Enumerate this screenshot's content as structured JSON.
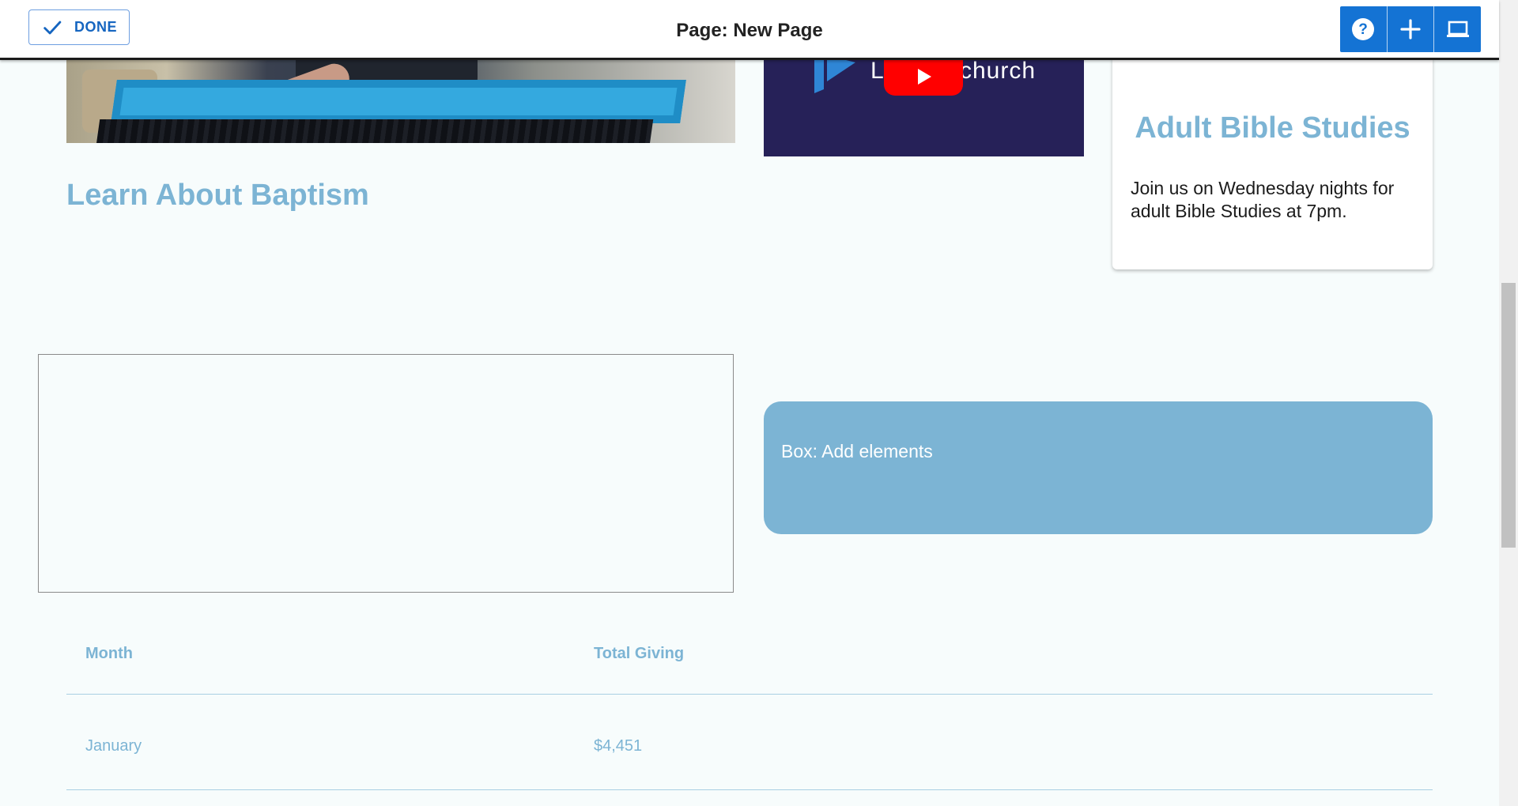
{
  "topbar": {
    "done_label": "DONE",
    "page_title": "Page: New Page",
    "tools": [
      "help-icon",
      "add-icon",
      "desktop-view-icon"
    ]
  },
  "video": {
    "text_left": "L",
    "text_right": "church",
    "play_icon": "youtube-play-icon"
  },
  "content": {
    "baptism_heading": "Learn About Baptism",
    "card_title": "Adult Bible Studies",
    "card_body": "Join us on Wednesday nights for adult Bible Studies at 7pm.",
    "box_label": "Box: Add elements"
  },
  "table": {
    "headers": [
      "Month",
      "Total Giving"
    ],
    "rows": [
      [
        "January",
        "$4,451"
      ]
    ]
  },
  "colors": {
    "accent": "#7cb4d4",
    "toolbar_blue": "#1473d4",
    "background": "#f7fcfc",
    "video_bg": "#262158"
  }
}
